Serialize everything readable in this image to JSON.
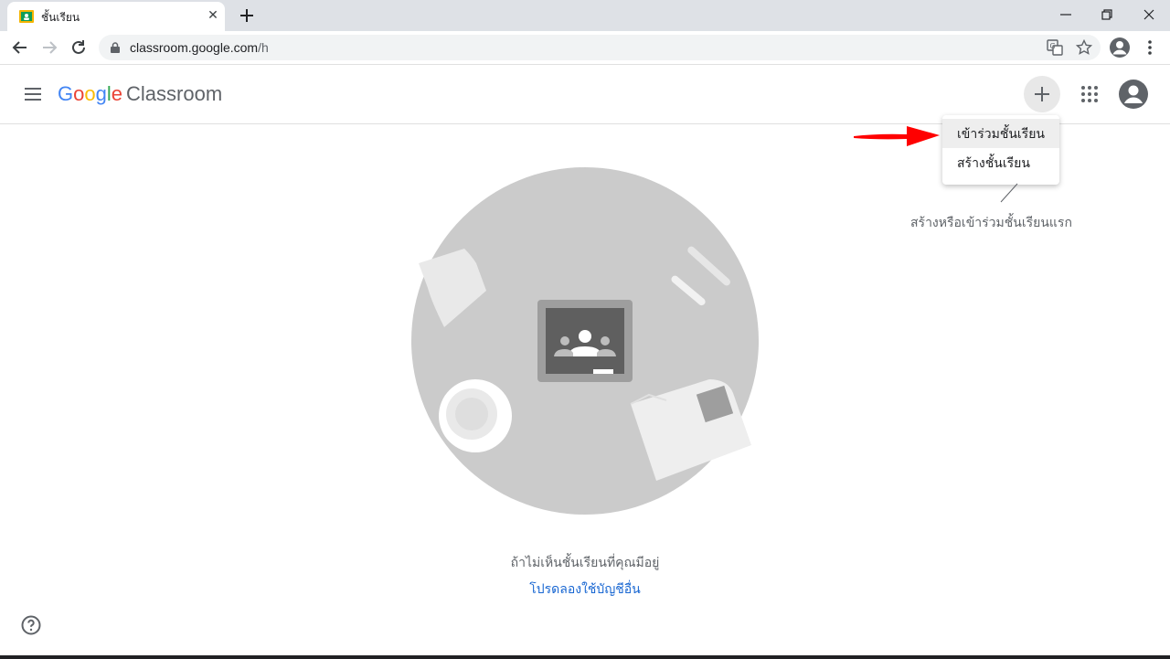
{
  "browser": {
    "tab_title": "ชั้นเรียน",
    "close_tab_glyph": "✕",
    "url_host": "classroom.google.com",
    "url_path": "/h"
  },
  "app": {
    "logo_letters": [
      "G",
      "o",
      "o",
      "g",
      "l",
      "e"
    ],
    "product_name": "Classroom"
  },
  "menu": {
    "items": [
      {
        "label": "เข้าร่วมชั้นเรียน"
      },
      {
        "label": "สร้างชั้นเรียน"
      }
    ]
  },
  "hint_text": "สร้างหรือเข้าร่วมชั้นเรียนแรก",
  "empty_state": {
    "message": "ถ้าไม่เห็นชั้นเรียนที่คุณมีอยู่",
    "link": "โปรดลองใช้บัญชีอื่น"
  },
  "colors": {
    "google_blue": "#4285f4",
    "google_red": "#ea4335",
    "google_yellow": "#fbbc05",
    "google_green": "#34a853",
    "link": "#1967d2",
    "annotation_arrow": "#ff0000"
  }
}
